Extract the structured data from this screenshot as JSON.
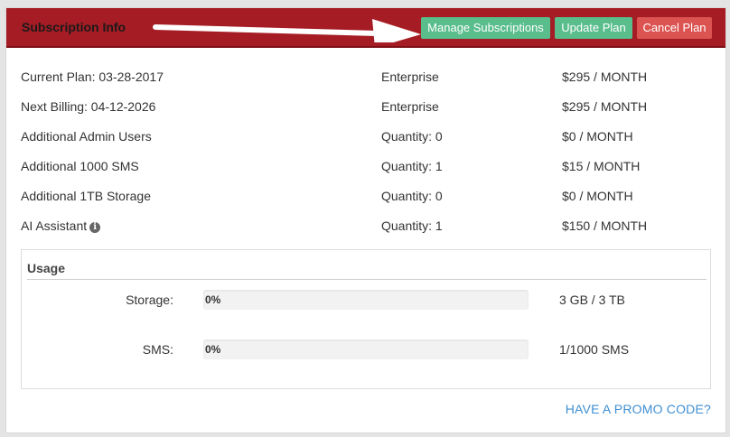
{
  "header": {
    "title": "Subscription Info",
    "buttons": {
      "manage": "Manage Subscriptions",
      "update": "Update Plan",
      "cancel": "Cancel Plan"
    }
  },
  "plan_rows": [
    {
      "name": "Current Plan: 03-28-2017",
      "detail": "Enterprise",
      "price": "$295 / MONTH"
    },
    {
      "name": "Next Billing: 04-12-2026",
      "detail": "Enterprise",
      "price": "$295 / MONTH"
    },
    {
      "name": "Additional Admin Users",
      "detail": "Quantity: 0",
      "price": "$0 / MONTH"
    },
    {
      "name": "Additional 1000 SMS",
      "detail": "Quantity: 1",
      "price": "$15 / MONTH"
    },
    {
      "name": "Additional 1TB Storage",
      "detail": "Quantity: 0",
      "price": "$0 / MONTH"
    },
    {
      "name": "AI Assistant",
      "detail": "Quantity: 1",
      "price": "$150 / MONTH"
    }
  ],
  "info_icon_glyph": "i",
  "usage": {
    "title": "Usage",
    "items": [
      {
        "label": "Storage:",
        "percent_text": "0%",
        "fraction": 0,
        "value": "3 GB / 3 TB"
      },
      {
        "label": "SMS:",
        "percent_text": "0%",
        "fraction": 0,
        "value": "1/1000 SMS"
      }
    ]
  },
  "promo_link": "HAVE A PROMO CODE?",
  "colors": {
    "header_bg": "#a51c24",
    "button_green": "#59bd8c",
    "button_red": "#dc5451",
    "link": "#3f8fd2"
  },
  "icons": {
    "arrow": "arrow-right-icon",
    "info": "info-circle-icon"
  }
}
